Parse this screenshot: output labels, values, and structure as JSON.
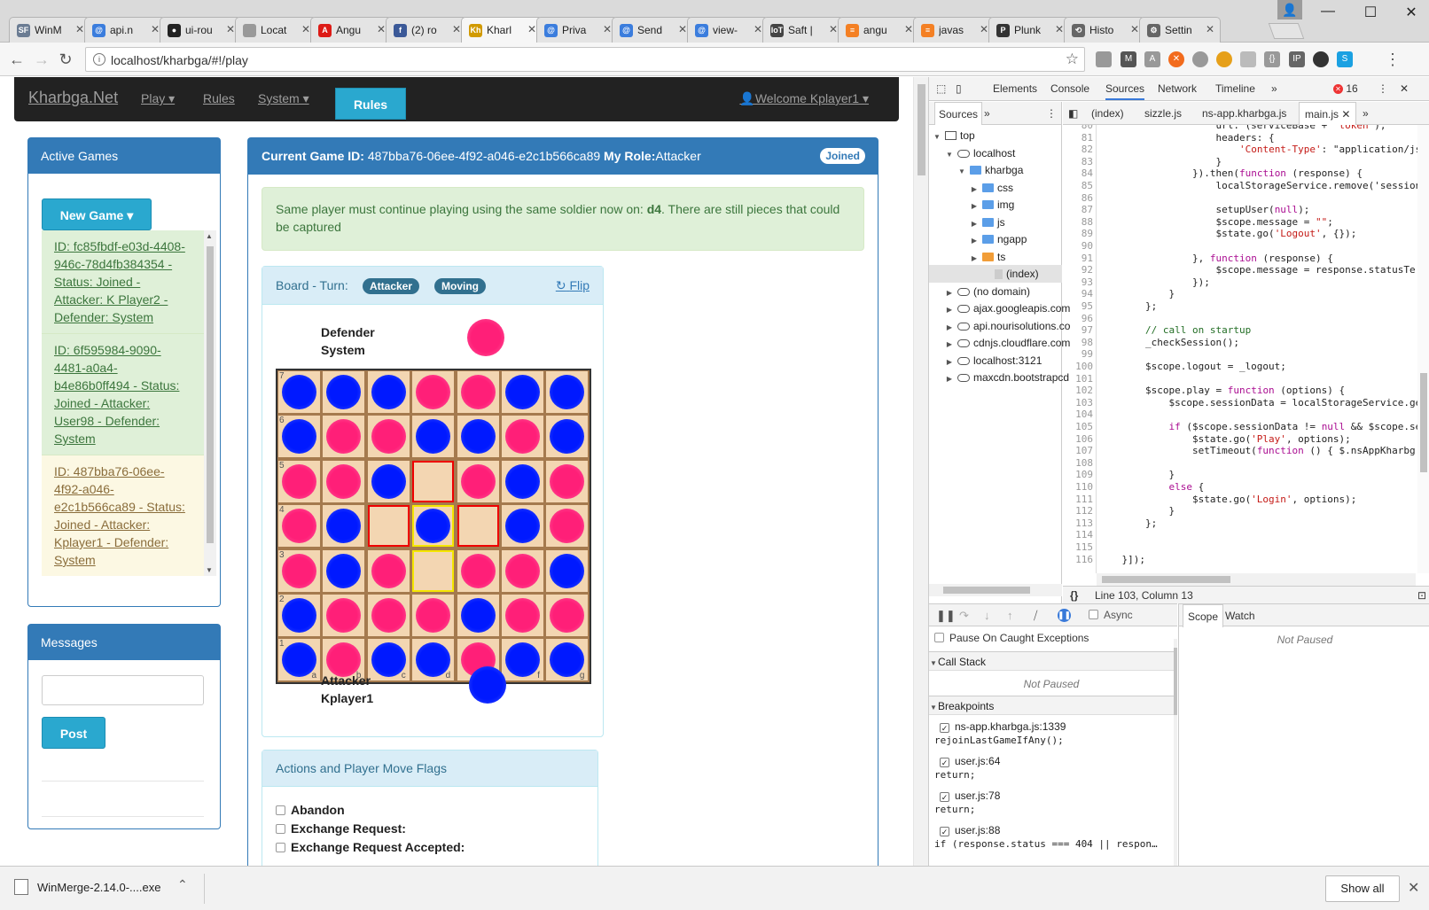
{
  "browser": {
    "tabs": [
      {
        "label": "WinM",
        "icon": "sf-icon",
        "color": "#6b7c93",
        "glyph": "SF"
      },
      {
        "label": "api.n",
        "icon": "at-icon",
        "color": "#3b7ddd",
        "glyph": "@"
      },
      {
        "label": "ui-rou",
        "icon": "github-icon",
        "color": "#222222",
        "glyph": "●"
      },
      {
        "label": "Locat",
        "icon": "page-icon",
        "color": "#999999",
        "glyph": ""
      },
      {
        "label": "Angu",
        "icon": "angular-icon",
        "color": "#dd1b16",
        "glyph": "A"
      },
      {
        "label": "(2) ro",
        "icon": "facebook-icon",
        "color": "#3b5998",
        "glyph": "f"
      },
      {
        "label": "Kharl",
        "icon": "kharbga-icon",
        "color": "#d19a00",
        "glyph": "Kh"
      },
      {
        "label": "Priva",
        "icon": "at-icon",
        "color": "#3b7ddd",
        "glyph": "@"
      },
      {
        "label": "Send",
        "icon": "at-icon",
        "color": "#3b7ddd",
        "glyph": "@"
      },
      {
        "label": "view-",
        "icon": "at-icon",
        "color": "#3b7ddd",
        "glyph": "@"
      },
      {
        "label": "Saft |",
        "icon": "iot-icon",
        "color": "#444444",
        "glyph": "IoT"
      },
      {
        "label": "angu",
        "icon": "stackoverflow-icon",
        "color": "#f48024",
        "glyph": "≡"
      },
      {
        "label": "javas",
        "icon": "stackoverflow-icon",
        "color": "#f48024",
        "glyph": "≡"
      },
      {
        "label": "Plunk",
        "icon": "plunker-icon",
        "color": "#333333",
        "glyph": "P"
      },
      {
        "label": "Histo",
        "icon": "history-icon",
        "color": "#666666",
        "glyph": "⟲"
      },
      {
        "label": "Settin",
        "icon": "gear-icon",
        "color": "#666666",
        "glyph": "⚙"
      }
    ],
    "active_tab": 6,
    "url": "localhost/kharbga/#!/play",
    "window": {
      "minimize": "—",
      "maximize": "☐",
      "close": "✕"
    }
  },
  "site": {
    "brand": "Kharbga.Net",
    "nav": {
      "play": "Play ▾",
      "rules": "Rules",
      "system": "System ▾"
    },
    "rules_button": "Rules",
    "welcome": "👤Welcome Kplayer1 ▾"
  },
  "active_games": {
    "title": "Active Games",
    "new_game": "New Game ▾",
    "games": [
      {
        "text": "ID: fc85fbdf-e03d-4408-946c-78d4fb384354 - Status: Joined - Attacker: K Player2 - Defender: System",
        "state": "ok"
      },
      {
        "text": "ID: 6f595984-9090-4481-a0a4-b4e86b0ff494 - Status: Joined - Attacker: User98 - Defender: System",
        "state": "ok"
      },
      {
        "text": "ID: 487bba76-06ee-4f92-a046-e2c1b566ca89 - Status: Joined - Attacker: Kplayer1 - Defender: System",
        "state": "cur"
      }
    ]
  },
  "messages": {
    "title": "Messages",
    "input_value": "",
    "post": "Post"
  },
  "game": {
    "header_label": "Current Game ID:",
    "game_id": "487bba76-06ee-4f92-a046-e2c1b566ca89",
    "role_label": "My Role:",
    "role": "Attacker",
    "badge": "Joined",
    "alert_prefix": "Same player must continue playing using the same soldier now on: ",
    "alert_cell": "d4",
    "alert_suffix": ". There are still pieces that could be captured",
    "board_label": "Board - Turn:",
    "turn": "Attacker",
    "state": "Moving",
    "flip": "Flip",
    "defender_line1": "Defender",
    "defender_line2": "System",
    "attacker_line1": "Attacker",
    "attacker_line2": "Kplayer1",
    "colors": {
      "pink": "#ff1f78",
      "blue": "#0019ff"
    },
    "board": {
      "rows": [
        "7",
        "6",
        "5",
        "4",
        "3",
        "2",
        "1"
      ],
      "cols": [
        "a",
        "b",
        "c",
        "d",
        "e",
        "f",
        "g"
      ],
      "cells": [
        [
          "B",
          "B",
          "B",
          "P",
          "P",
          "B",
          "B"
        ],
        [
          "B",
          "P",
          "P",
          "B",
          "B",
          "P",
          "B"
        ],
        [
          "P",
          "P",
          "B",
          "_",
          "P",
          "B",
          "P"
        ],
        [
          "P",
          "B",
          "_",
          "B",
          "_",
          "B",
          "P"
        ],
        [
          "P",
          "B",
          "P",
          "_",
          "P",
          "P",
          "B"
        ],
        [
          "B",
          "P",
          "P",
          "P",
          "B",
          "P",
          "P"
        ],
        [
          "B",
          "P",
          "B",
          "B",
          "P",
          "B",
          "B"
        ]
      ],
      "highlights_red": [
        "c4",
        "d4",
        "e4",
        "d5"
      ],
      "highlights_yellow": [
        "d4",
        "d3"
      ]
    },
    "actions_title": "Actions and Player Move Flags",
    "actions": [
      "Abandon",
      "Exchange Request:",
      "Exchange Request Accepted:"
    ]
  },
  "devtools": {
    "tabs": [
      "Elements",
      "Console",
      "Sources",
      "Network",
      "Timeline",
      "»"
    ],
    "selected_tab": "Sources",
    "error_count": "16",
    "nav_tabs": [
      "Sources",
      "»"
    ],
    "tree": [
      {
        "label": "top",
        "indent": 0,
        "kind": "win",
        "tri": "▼"
      },
      {
        "label": "localhost",
        "indent": 1,
        "kind": "cloud",
        "tri": "▼"
      },
      {
        "label": "kharbga",
        "indent": 2,
        "kind": "folder",
        "tri": "▼"
      },
      {
        "label": "css",
        "indent": 3,
        "kind": "folder",
        "tri": "▶"
      },
      {
        "label": "img",
        "indent": 3,
        "kind": "folder",
        "tri": "▶"
      },
      {
        "label": "js",
        "indent": 3,
        "kind": "folder",
        "tri": "▶"
      },
      {
        "label": "ngapp",
        "indent": 3,
        "kind": "folder",
        "tri": "▶"
      },
      {
        "label": "ts",
        "indent": 3,
        "kind": "orange",
        "tri": "▶"
      },
      {
        "label": "(index)",
        "indent": 4,
        "kind": "file",
        "tri": "",
        "sel": true
      },
      {
        "label": "(no domain)",
        "indent": 1,
        "kind": "cloud",
        "tri": "▶"
      },
      {
        "label": "ajax.googleapis.com",
        "indent": 1,
        "kind": "cloud",
        "tri": "▶"
      },
      {
        "label": "api.nourisolutions.co",
        "indent": 1,
        "kind": "cloud",
        "tri": "▶"
      },
      {
        "label": "cdnjs.cloudflare.com",
        "indent": 1,
        "kind": "cloud",
        "tri": "▶"
      },
      {
        "label": "localhost:3121",
        "indent": 1,
        "kind": "cloud",
        "tri": "▶"
      },
      {
        "label": "maxcdn.bootstrapcd",
        "indent": 1,
        "kind": "cloud",
        "tri": "▶"
      }
    ],
    "editor_tabs": [
      "(index)",
      "sizzle.js",
      "ns-app.kharbga.js",
      "main.js ✕",
      "»"
    ],
    "code": [
      {
        "n": "80",
        "t": "                    url: (serviceBase + 'token'),"
      },
      {
        "n": "81",
        "t": "                    headers: {"
      },
      {
        "n": "82",
        "t": "                        'Content-Type': \"application/js"
      },
      {
        "n": "83",
        "t": "                    }"
      },
      {
        "n": "84",
        "t": "                }).then(function (response) {"
      },
      {
        "n": "85",
        "t": "                    localStorageService.remove('session"
      },
      {
        "n": "86",
        "t": ""
      },
      {
        "n": "87",
        "t": "                    setupUser(null);"
      },
      {
        "n": "88",
        "t": "                    $scope.message = \"\";"
      },
      {
        "n": "89",
        "t": "                    $state.go('Logout', {});"
      },
      {
        "n": "90",
        "t": ""
      },
      {
        "n": "91",
        "t": "                }, function (response) {"
      },
      {
        "n": "92",
        "t": "                    $scope.message = response.statusTe"
      },
      {
        "n": "93",
        "t": "                });"
      },
      {
        "n": "94",
        "t": "            }"
      },
      {
        "n": "95",
        "t": "        };"
      },
      {
        "n": "96",
        "t": ""
      },
      {
        "n": "97",
        "t": "        // call on startup"
      },
      {
        "n": "98",
        "t": "        _checkSession();"
      },
      {
        "n": "99",
        "t": ""
      },
      {
        "n": "100",
        "t": "        $scope.logout = _logout;"
      },
      {
        "n": "101",
        "t": ""
      },
      {
        "n": "102",
        "t": "        $scope.play = function (options) {"
      },
      {
        "n": "103",
        "t": "            $scope.sessionData = localStorageService.ge"
      },
      {
        "n": "104",
        "t": ""
      },
      {
        "n": "105",
        "t": "            if ($scope.sessionData != null && $scope.se"
      },
      {
        "n": "106",
        "t": "                $state.go('Play', options);"
      },
      {
        "n": "107",
        "t": "                setTimeout(function () { $.nsAppKharbg"
      },
      {
        "n": "108",
        "t": ""
      },
      {
        "n": "109",
        "t": "            }"
      },
      {
        "n": "110",
        "t": "            else {"
      },
      {
        "n": "111",
        "t": "                $state.go('Login', options);"
      },
      {
        "n": "112",
        "t": "            }"
      },
      {
        "n": "113",
        "t": "        };"
      },
      {
        "n": "114",
        "t": ""
      },
      {
        "n": "115",
        "t": ""
      },
      {
        "n": "116",
        "t": "    }]);"
      }
    ],
    "status": "Line 103, Column 13",
    "async": "Async",
    "pause_caught": "Pause On Caught Exceptions",
    "call_stack": "Call Stack",
    "not_paused": "Not Paused",
    "breakpoints_title": "Breakpoints",
    "breakpoints": [
      {
        "file": "ns-app.kharbga.js:1339",
        "code": "rejoinLastGameIfAny();"
      },
      {
        "file": "user.js:64",
        "code": "return;"
      },
      {
        "file": "user.js:78",
        "code": "return;"
      },
      {
        "file": "user.js:88",
        "code": "if (response.status === 404 || respon…"
      }
    ],
    "scope_tabs": [
      "Scope",
      "Watch"
    ],
    "scope_not_paused": "Not Paused"
  },
  "downloads": {
    "file": "WinMerge-2.14.0-....exe",
    "show_all": "Show all"
  }
}
